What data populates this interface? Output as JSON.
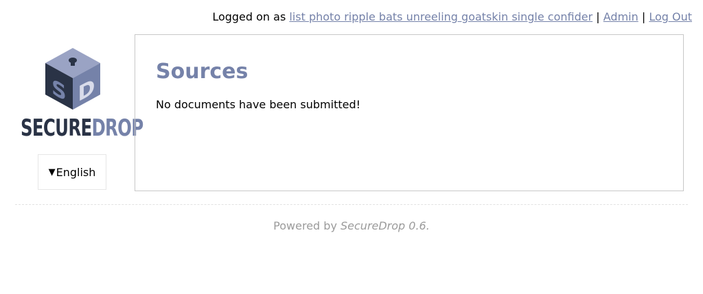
{
  "header": {
    "logged_on_prefix": "Logged on as ",
    "username": "list photo ripple bats unreeling goatskin single confider",
    "admin_link": "Admin",
    "logout_link": "Log Out",
    "separator": "|"
  },
  "sidebar": {
    "logo_secure": "SECURE",
    "logo_drop": "DROP",
    "logo_icon_letters": [
      "S",
      "D"
    ],
    "language_toggle": "▼",
    "language": "English"
  },
  "main": {
    "title": "Sources",
    "message": "No documents have been submitted!"
  },
  "footer": {
    "prefix": "Powered by ",
    "product": "SecureDrop 0.6."
  },
  "colors": {
    "accent": "#7582a9",
    "dark": "#2a3346",
    "muted": "#9b9b9b",
    "border": "#c8c8c8"
  },
  "icons": {
    "logo": "securedrop-cube-logo",
    "language_toggle": "triangle-down-icon"
  }
}
